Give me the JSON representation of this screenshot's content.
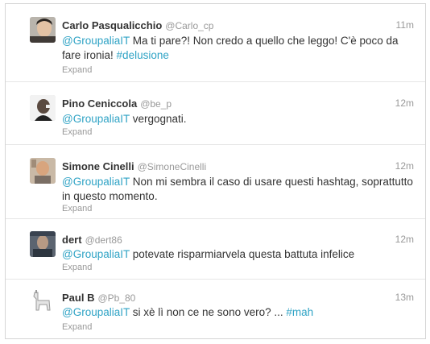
{
  "tweets": [
    {
      "fullname": "Carlo Pasqualicchio",
      "username": "@Carlo_cp",
      "time": "11m",
      "mention": "@GroupaliaIT",
      "text": " Ma ti pare?! Non credo a quello che leggo! C'è poco da fare ironia! ",
      "hashtag": "#delusione",
      "expand": "Expand"
    },
    {
      "fullname": "Pino Ceniccola",
      "username": "@be_p",
      "time": "12m",
      "mention": "@GroupaliaIT",
      "text": " vergognati.",
      "hashtag": "",
      "expand": "Expand"
    },
    {
      "fullname": "Simone Cinelli",
      "username": "@SimoneCinelli",
      "time": "12m",
      "mention": "@GroupaliaIT",
      "text": " Non mi sembra il caso di usare questi hashtag, soprattutto in questo momento.",
      "hashtag": "",
      "expand": "Expand"
    },
    {
      "fullname": "dert",
      "username": "@dert86",
      "time": "12m",
      "mention": "@GroupaliaIT",
      "text": " potevate risparmiarvela questa battuta infelice",
      "hashtag": "",
      "expand": "Expand"
    },
    {
      "fullname": "Paul B",
      "username": "@Pb_80",
      "time": "13m",
      "mention": "@GroupaliaIT",
      "text": " si xè lì non ce ne sono vero? ... ",
      "hashtag": "#mah",
      "expand": "Expand"
    }
  ],
  "colors": {
    "link": "#2fa3c5",
    "meta": "#999999",
    "text": "#333333"
  }
}
